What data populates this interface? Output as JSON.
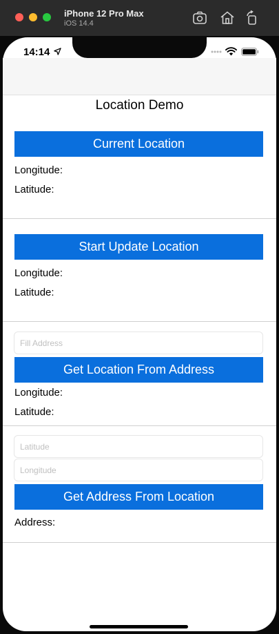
{
  "window": {
    "device_name": "iPhone 12 Pro Max",
    "os_version": "iOS 14.4"
  },
  "status_bar": {
    "time": "14:14"
  },
  "page": {
    "title": "Location Demo"
  },
  "section_current": {
    "button_label": "Current Location",
    "longitude_label": "Longitude:",
    "latitude_label": "Latitude:"
  },
  "section_update": {
    "button_label": "Start Update Location",
    "longitude_label": "Longitude:",
    "latitude_label": "Latitude:"
  },
  "section_from_address": {
    "address_placeholder": "Fill Address",
    "button_label": "Get Location From Address",
    "longitude_label": "Longitude:",
    "latitude_label": "Latitude:"
  },
  "section_from_location": {
    "latitude_placeholder": "Latitude",
    "longitude_placeholder": "Longitude",
    "button_label": "Get Address From Location",
    "address_label": "Address:"
  },
  "colors": {
    "button_blue": "#0a6fdd"
  }
}
